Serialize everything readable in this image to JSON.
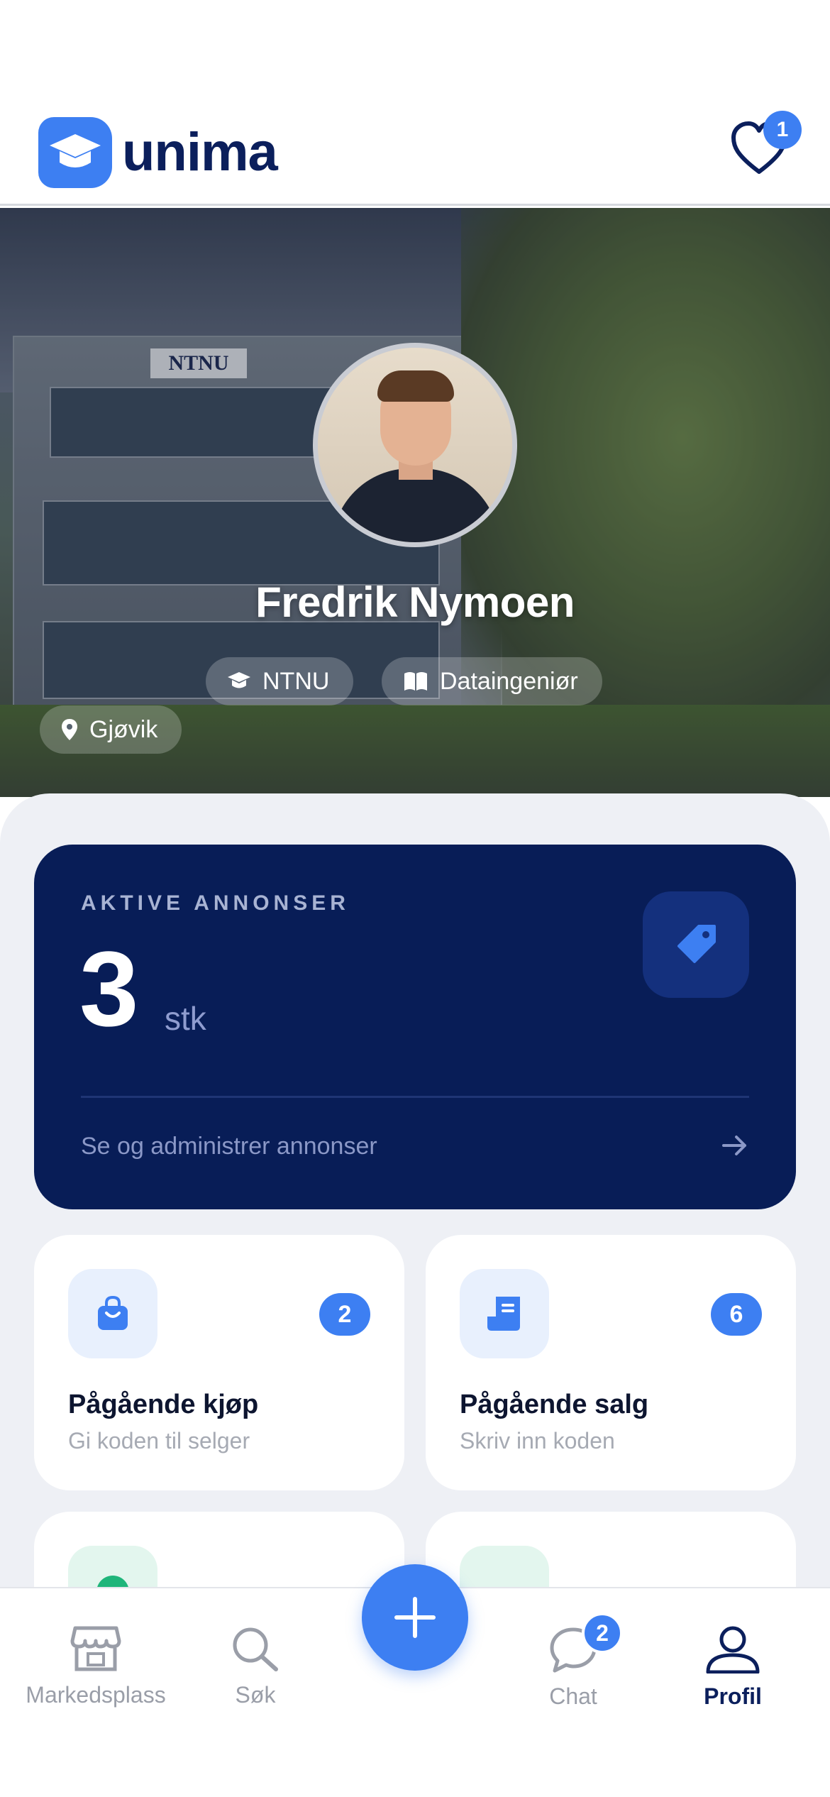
{
  "app": {
    "name": "unima",
    "favorites_count": "1"
  },
  "profile": {
    "name": "Fredrik Nymoen",
    "school": "NTNU",
    "study": "Dataingeniør",
    "city": "Gjøvik",
    "hero_sign": "NTNU"
  },
  "active_listings": {
    "label": "AKTIVE ANNONSER",
    "count": "3",
    "unit": "stk",
    "link": "Se og administrer annonser"
  },
  "tiles": [
    {
      "title": "Pågående kjøp",
      "subtitle": "Gi koden til selger",
      "badge": "2",
      "icon": "shopping-bag-icon"
    },
    {
      "title": "Pågående salg",
      "subtitle": "Skriv inn koden",
      "badge": "6",
      "icon": "receipt-icon"
    }
  ],
  "nav": {
    "items": [
      {
        "label": "Markedsplass",
        "icon": "storefront-icon"
      },
      {
        "label": "Søk",
        "icon": "search-icon"
      },
      {
        "label": "Chat",
        "icon": "chat-icon",
        "badge": "2"
      },
      {
        "label": "Profil",
        "icon": "person-icon",
        "active": true
      }
    ],
    "fab_icon": "plus-icon"
  },
  "colors": {
    "accent": "#3d7ff2",
    "navy": "#081d57",
    "brand_text": "#0b1f5c",
    "sheet_bg": "#eef0f5"
  }
}
